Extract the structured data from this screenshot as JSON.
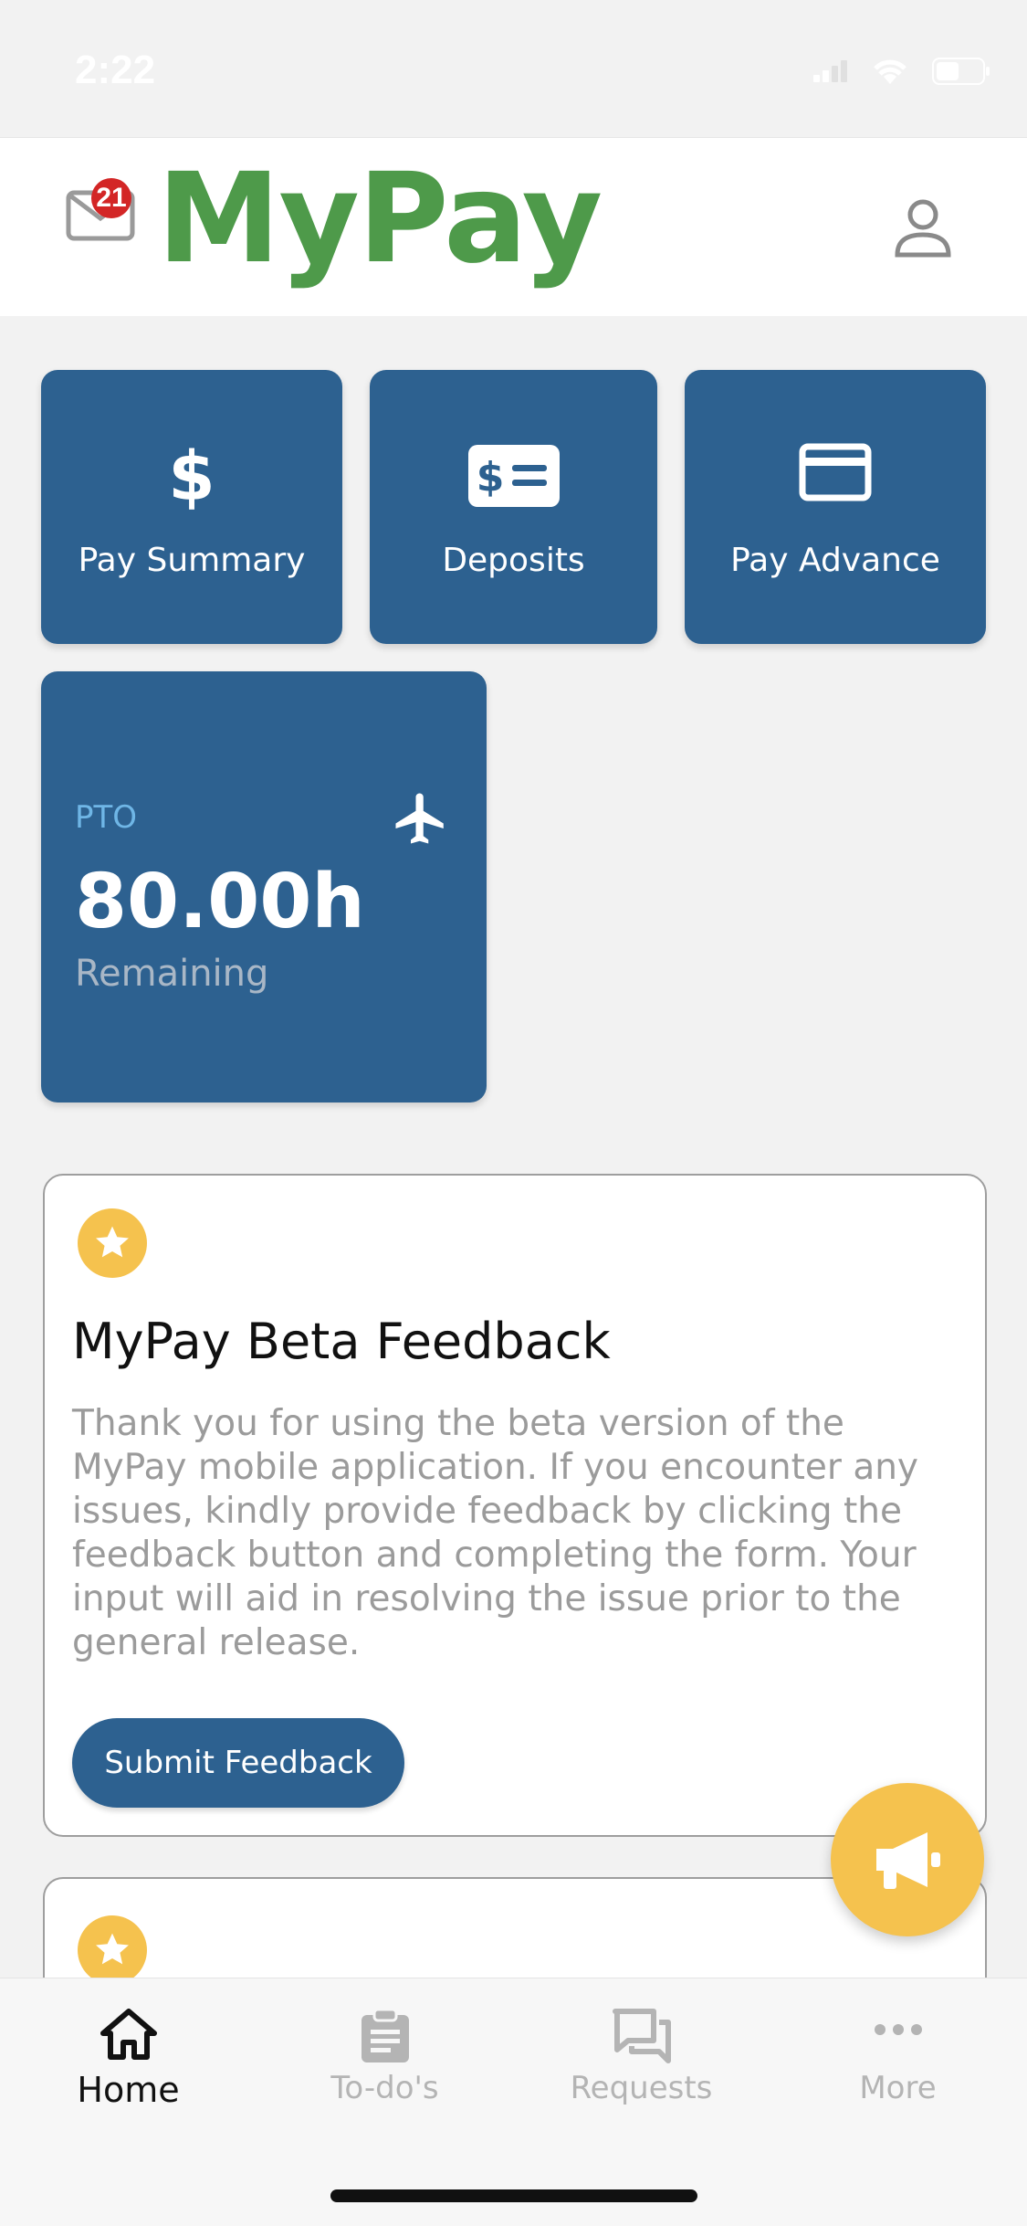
{
  "status_bar": {
    "time": "2:22"
  },
  "header": {
    "logo": "MyPay",
    "mail_badge": "21"
  },
  "tiles": [
    {
      "label": "Pay Summary",
      "icon": "dollar-icon"
    },
    {
      "label": "Deposits",
      "icon": "deposit-icon"
    },
    {
      "label": "Pay Advance",
      "icon": "credit-card-icon"
    }
  ],
  "pto": {
    "label": "PTO",
    "value": "80.00h",
    "sub": "Remaining",
    "icon": "airplane-icon"
  },
  "feedback_card": {
    "title": "MyPay Beta Feedback",
    "body": "Thank you for using the beta version of the MyPay mobile application. If you encounter any issues, kindly provide feedback by clicking the feedback button and completing the form. Your input will aid in resolving the issue prior to the general release.",
    "button": "Submit Feedback"
  },
  "tabbar": {
    "items": [
      {
        "label": "Home",
        "icon": "home-icon",
        "active": true
      },
      {
        "label": "To-do's",
        "icon": "clipboard-icon",
        "active": false
      },
      {
        "label": "Requests",
        "icon": "chat-icon",
        "active": false
      },
      {
        "label": "More",
        "icon": "more-icon",
        "active": false
      }
    ]
  },
  "colors": {
    "primary": "#2d6190",
    "accent": "#f5c24e",
    "logo": "#4e9a4a"
  }
}
